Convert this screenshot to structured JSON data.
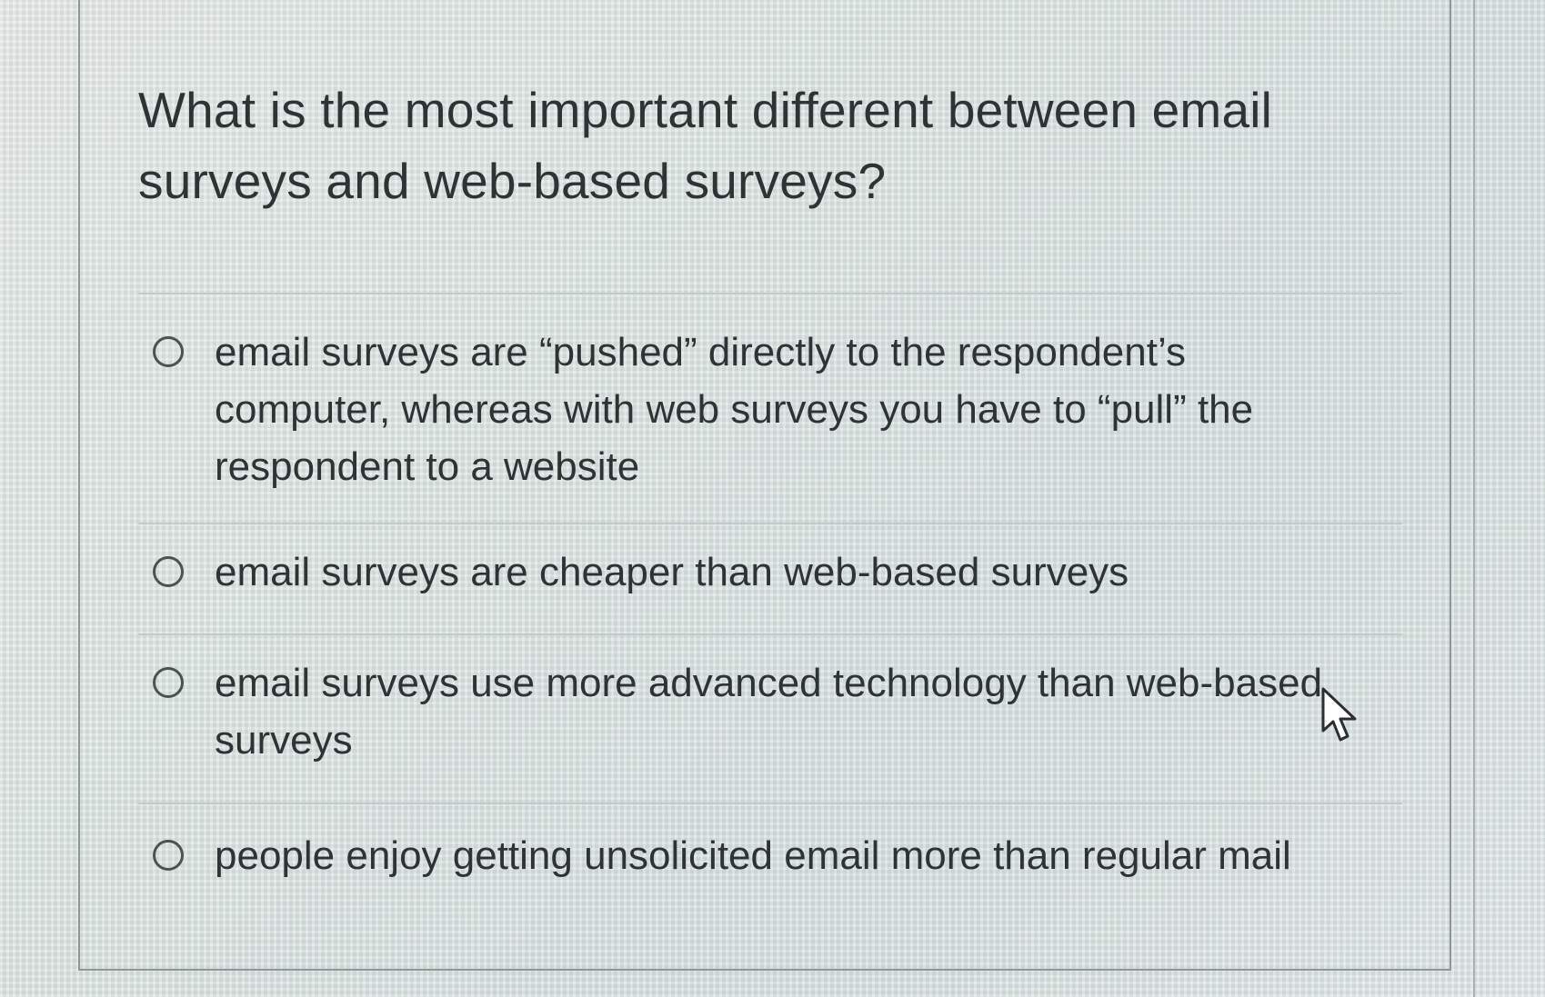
{
  "question": {
    "text": "What is the most important different between email surveys and web-based surveys?"
  },
  "answers": [
    {
      "label": "email surveys are “pushed” directly to the respondent’s computer, whereas with web surveys you have to “pull” the respondent to a website",
      "selected": false
    },
    {
      "label": "email surveys are cheaper than web-based surveys",
      "selected": false
    },
    {
      "label": "email surveys use more advanced technology than web-based surveys",
      "selected": false
    },
    {
      "label": "people enjoy getting unsolicited email more than regular mail",
      "selected": false
    }
  ],
  "icons": {
    "radio": "radio-circle-icon",
    "cursor": "mouse-pointer-icon"
  },
  "colors": {
    "text": "#2e3436",
    "radio_border": "#4a5254",
    "divider": "#c3cbca",
    "frame": "#8f9796"
  }
}
